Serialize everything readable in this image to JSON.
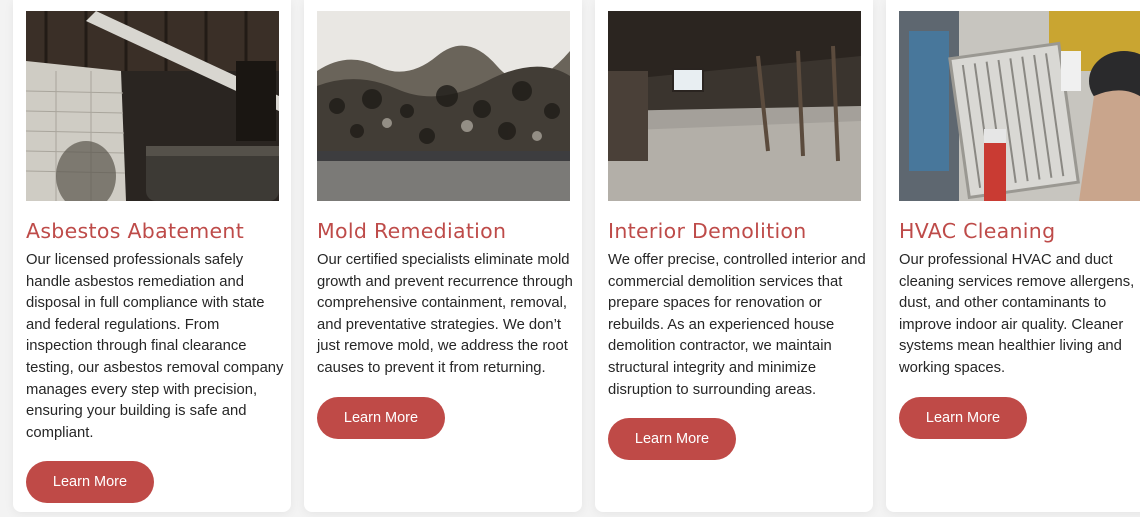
{
  "cards": [
    {
      "title": "Asbestos Abatement",
      "text": "Our licensed professionals safely handle asbestos remediation and disposal in full compliance with state and federal regulations. From inspection through final clearance testing, our asbestos removal company manages every step with precision, ensuring your building is safe and compliant.",
      "button": "Learn More"
    },
    {
      "title": "Mold Remediation",
      "text": "Our certified specialists eliminate mold growth and prevent recurrence through comprehensive containment, removal, and preventative strategies. We don’t just remove mold, we address the root causes to prevent it from returning.",
      "button": "Learn More"
    },
    {
      "title": "Interior Demolition",
      "text": "We offer precise, controlled interior and commercial demolition services that prepare spaces for renovation or rebuilds. As an experienced house demolition contractor, we maintain structural integrity and minimize disruption to surrounding areas.",
      "button": "Learn More"
    },
    {
      "title": "HVAC Cleaning",
      "text": "Our professional HVAC and duct cleaning services remove allergens, dust, and other contaminants to improve indoor air quality. Cleaner systems mean healthier living and working spaces.",
      "button": "Learn More"
    }
  ],
  "colors": {
    "accent": "#be4b49",
    "text": "#262626",
    "card": "#ffffff"
  }
}
